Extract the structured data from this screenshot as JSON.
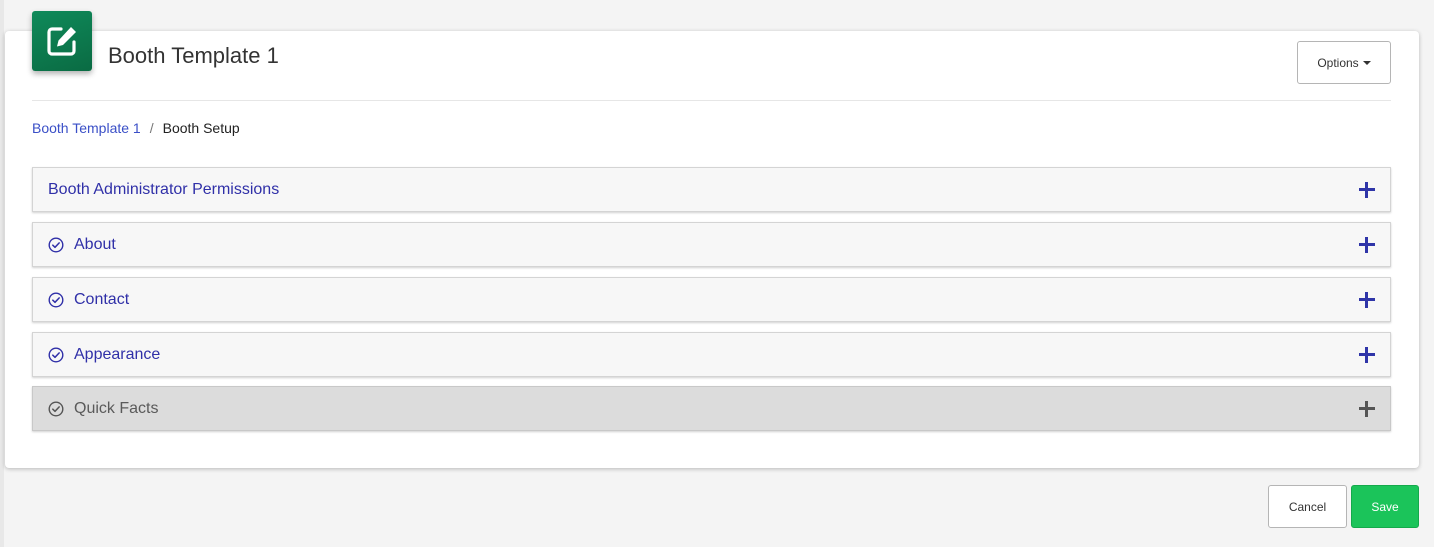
{
  "header": {
    "title": "Booth Template 1",
    "icon": "edit-square-icon",
    "icon_color": "#0f8a5a",
    "options_label": "Options"
  },
  "breadcrumb": {
    "items": [
      {
        "label": "Booth Template 1",
        "link": true
      },
      {
        "label": "Booth Setup",
        "link": false
      }
    ],
    "separator": "/"
  },
  "panels": [
    {
      "label": "Booth Administrator Permissions",
      "status_icon": null,
      "enabled": true
    },
    {
      "label": "About",
      "status_icon": "check-circle-icon",
      "enabled": true
    },
    {
      "label": "Contact",
      "status_icon": "check-circle-icon",
      "enabled": true
    },
    {
      "label": "Appearance",
      "status_icon": "check-circle-icon",
      "enabled": true
    },
    {
      "label": "Quick Facts",
      "status_icon": "check-circle-icon",
      "enabled": false
    }
  ],
  "footer": {
    "cancel_label": "Cancel",
    "save_label": "Save",
    "save_color": "#1bc45a"
  },
  "colors": {
    "link": "#3a4fc7",
    "panel_title": "#3030a8"
  }
}
